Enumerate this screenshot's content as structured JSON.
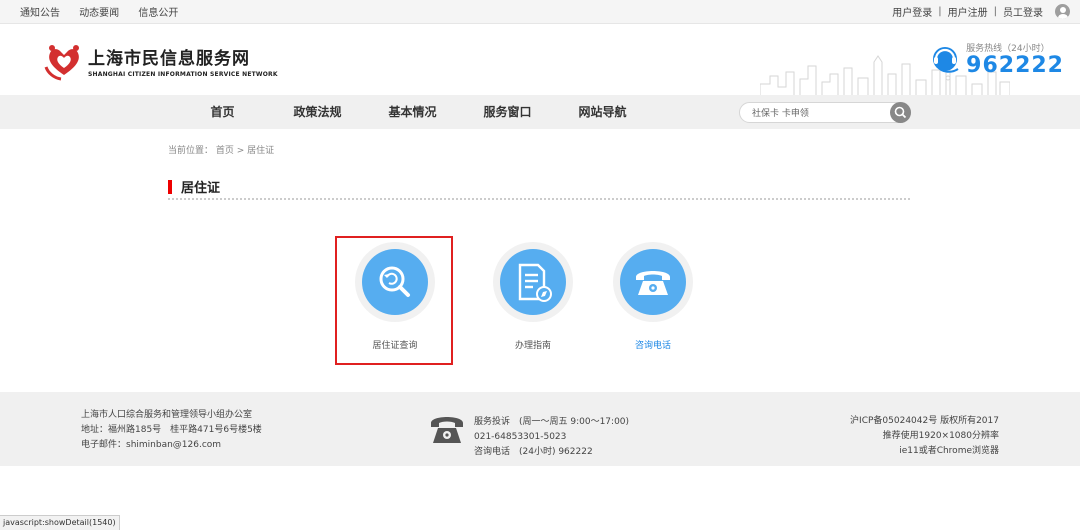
{
  "topbar": {
    "links": [
      "通知公告",
      "动态要闻",
      "信息公开"
    ],
    "user_login": "用户登录",
    "user_register": "用户注册",
    "staff_login": "员工登录",
    "sep": "|"
  },
  "header": {
    "logo_cn": "上海市民信息服务网",
    "logo_en": "SHANGHAI CITIZEN INFORMATION SERVICE NETWORK",
    "hotline_label": "服务热线（24小时）",
    "hotline_number": "962222",
    "accent_color": "#1e88e5"
  },
  "nav": {
    "items": [
      "首页",
      "政策法规",
      "基本情况",
      "服务窗口",
      "网站导航"
    ],
    "search_value": "社保卡 卡申领"
  },
  "breadcrumb": {
    "prefix": "当前位置：",
    "home": "首页",
    "arrow": " > ",
    "current": "居住证"
  },
  "page": {
    "title": "居住证",
    "cards": [
      {
        "label": "居住证查询",
        "icon": "search-refresh-icon"
      },
      {
        "label": "办理指南",
        "icon": "document-compass-icon"
      },
      {
        "label": "咨询电话",
        "icon": "telephone-icon"
      }
    ]
  },
  "footer": {
    "org": "上海市人口综合服务和管理领导小组办公室",
    "address": "地址：福州路185号　桂平路471号6号楼5楼",
    "email": "电子邮件：shiminban@126.com",
    "complaint": "服务投诉　(周一～周五 9:00～17:00)",
    "complaint_phone": "021-64853301-5023",
    "consult": "咨询电话　(24小时)  962222",
    "icp": "沪ICP备05024042号 版权所有2017",
    "resolution": "推荐使用1920×1080分辨率",
    "browser": "ie11或者Chrome浏览器"
  },
  "status_bar": "javascript:showDetail(1540)"
}
